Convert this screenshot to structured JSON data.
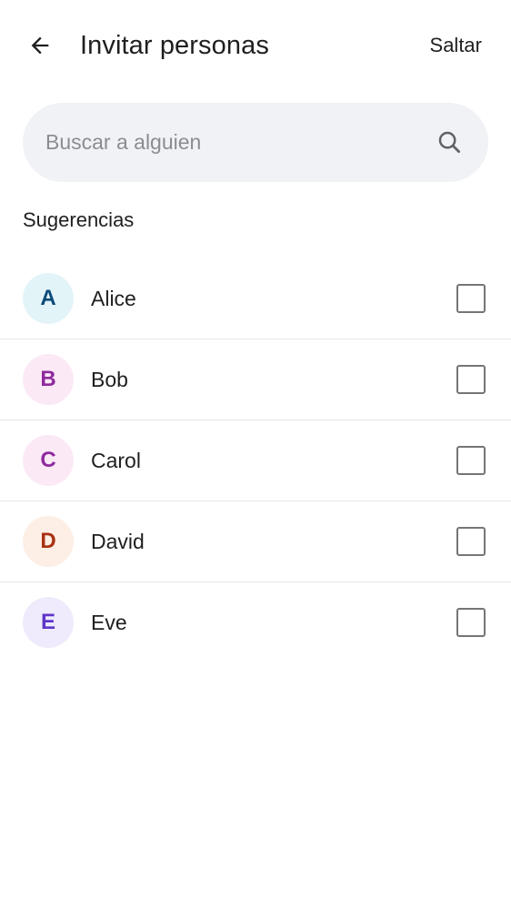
{
  "header": {
    "title": "Invitar personas",
    "skip_label": "Saltar",
    "back_icon": "arrow-left-icon"
  },
  "search": {
    "placeholder": "Buscar a alguien",
    "value": "",
    "icon": "search-icon"
  },
  "suggestions": {
    "title": "Sugerencias",
    "contacts": [
      {
        "initial": "A",
        "name": "Alice",
        "checked": false,
        "avatar_bg": "#e3f4f8",
        "avatar_fg": "#0d4a7a"
      },
      {
        "initial": "B",
        "name": "Bob",
        "checked": false,
        "avatar_bg": "#fbe9f6",
        "avatar_fg": "#8e2a9e"
      },
      {
        "initial": "C",
        "name": "Carol",
        "checked": false,
        "avatar_bg": "#fbe9f6",
        "avatar_fg": "#8e2a9e"
      },
      {
        "initial": "D",
        "name": "David",
        "checked": false,
        "avatar_bg": "#fdeee6",
        "avatar_fg": "#a83214"
      },
      {
        "initial": "E",
        "name": "Eve",
        "checked": false,
        "avatar_bg": "#efebfc",
        "avatar_fg": "#5e35c8"
      }
    ]
  }
}
